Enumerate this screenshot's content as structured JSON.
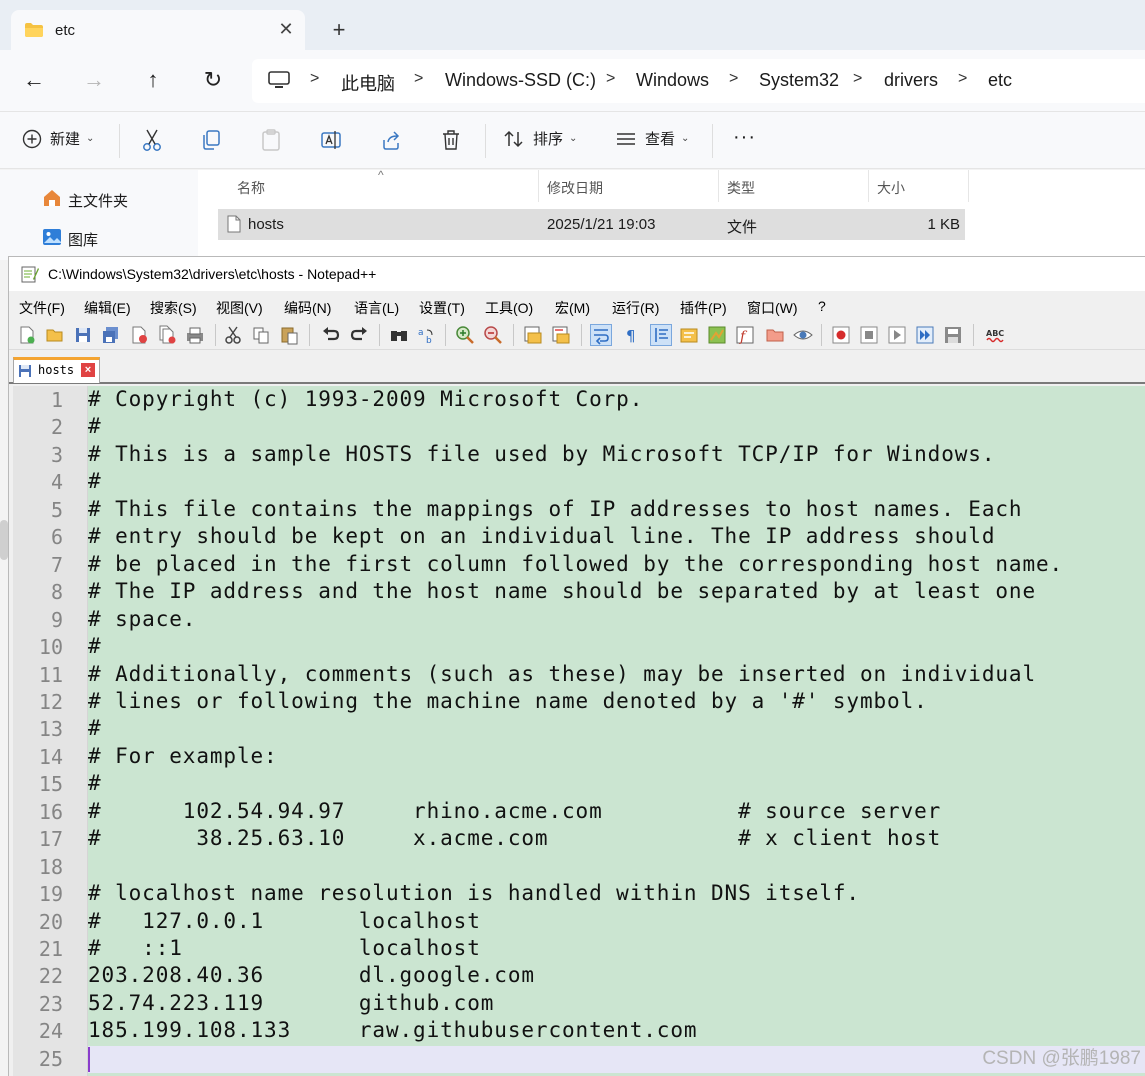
{
  "explorer": {
    "tab_title": "etc",
    "new_tab": "+",
    "breadcrumb": [
      "此电脑",
      "Windows-SSD (C:)",
      "Windows",
      "System32",
      "drivers",
      "etc"
    ],
    "commands": {
      "new": "新建",
      "sort": "排序",
      "view": "查看",
      "more": "···"
    },
    "sidebar": [
      {
        "label": "主文件夹",
        "icon": "home-icon"
      },
      {
        "label": "图库",
        "icon": "gallery-icon"
      }
    ],
    "columns": {
      "name": "名称",
      "modified": "修改日期",
      "type": "类型",
      "size": "大小"
    },
    "files": [
      {
        "name": "hosts",
        "modified": "2025/1/21 19:03",
        "type": "文件",
        "size": "1 KB"
      }
    ]
  },
  "notepad": {
    "title": "C:\\Windows\\System32\\drivers\\etc\\hosts - Notepad++",
    "menu": [
      "文件(F)",
      "编辑(E)",
      "搜索(S)",
      "视图(V)",
      "编码(N)",
      "语言(L)",
      "设置(T)",
      "工具(O)",
      "宏(M)",
      "运行(R)",
      "插件(P)",
      "窗口(W)",
      "?"
    ],
    "tab_name": "hosts",
    "lines": [
      "# Copyright (c) 1993-2009 Microsoft Corp.",
      "#",
      "# This is a sample HOSTS file used by Microsoft TCP/IP for Windows.",
      "#",
      "# This file contains the mappings of IP addresses to host names. Each",
      "# entry should be kept on an individual line. The IP address should",
      "# be placed in the first column followed by the corresponding host name.",
      "# The IP address and the host name should be separated by at least one",
      "# space.",
      "#",
      "# Additionally, comments (such as these) may be inserted on individual",
      "# lines or following the machine name denoted by a '#' symbol.",
      "#",
      "# For example:",
      "#",
      "#      102.54.94.97     rhino.acme.com          # source server",
      "#       38.25.63.10     x.acme.com              # x client host",
      "",
      "# localhost name resolution is handled within DNS itself.",
      "#   127.0.0.1       localhost",
      "#   ::1             localhost",
      "203.208.40.36       dl.google.com",
      "52.74.223.119       github.com",
      "185.199.108.133     raw.githubusercontent.com",
      ""
    ]
  },
  "watermark": "CSDN @张鹏1987"
}
